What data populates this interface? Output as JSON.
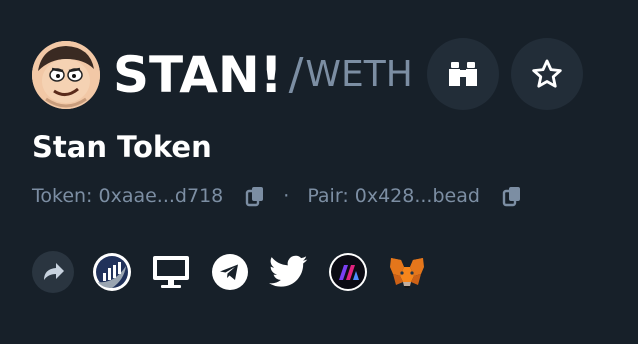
{
  "token": {
    "symbol": "STAN!",
    "separator": "/",
    "quote_symbol": "WETH",
    "name": "Stan Token"
  },
  "addresses": {
    "token_label": "Token: 0xaae...d718",
    "separator": "·",
    "pair_label": "Pair: 0x428...bead"
  },
  "colors": {
    "background": "#172029",
    "muted_text": "#7c8ea3",
    "button_bg": "#222d38"
  },
  "icons": {
    "header_buttons": [
      "binoculars-icon",
      "star-icon"
    ],
    "links": [
      "share-icon",
      "etherscan-icon",
      "website-icon",
      "telegram-icon",
      "twitter-icon",
      "dextools-icon",
      "metamask-icon"
    ]
  }
}
